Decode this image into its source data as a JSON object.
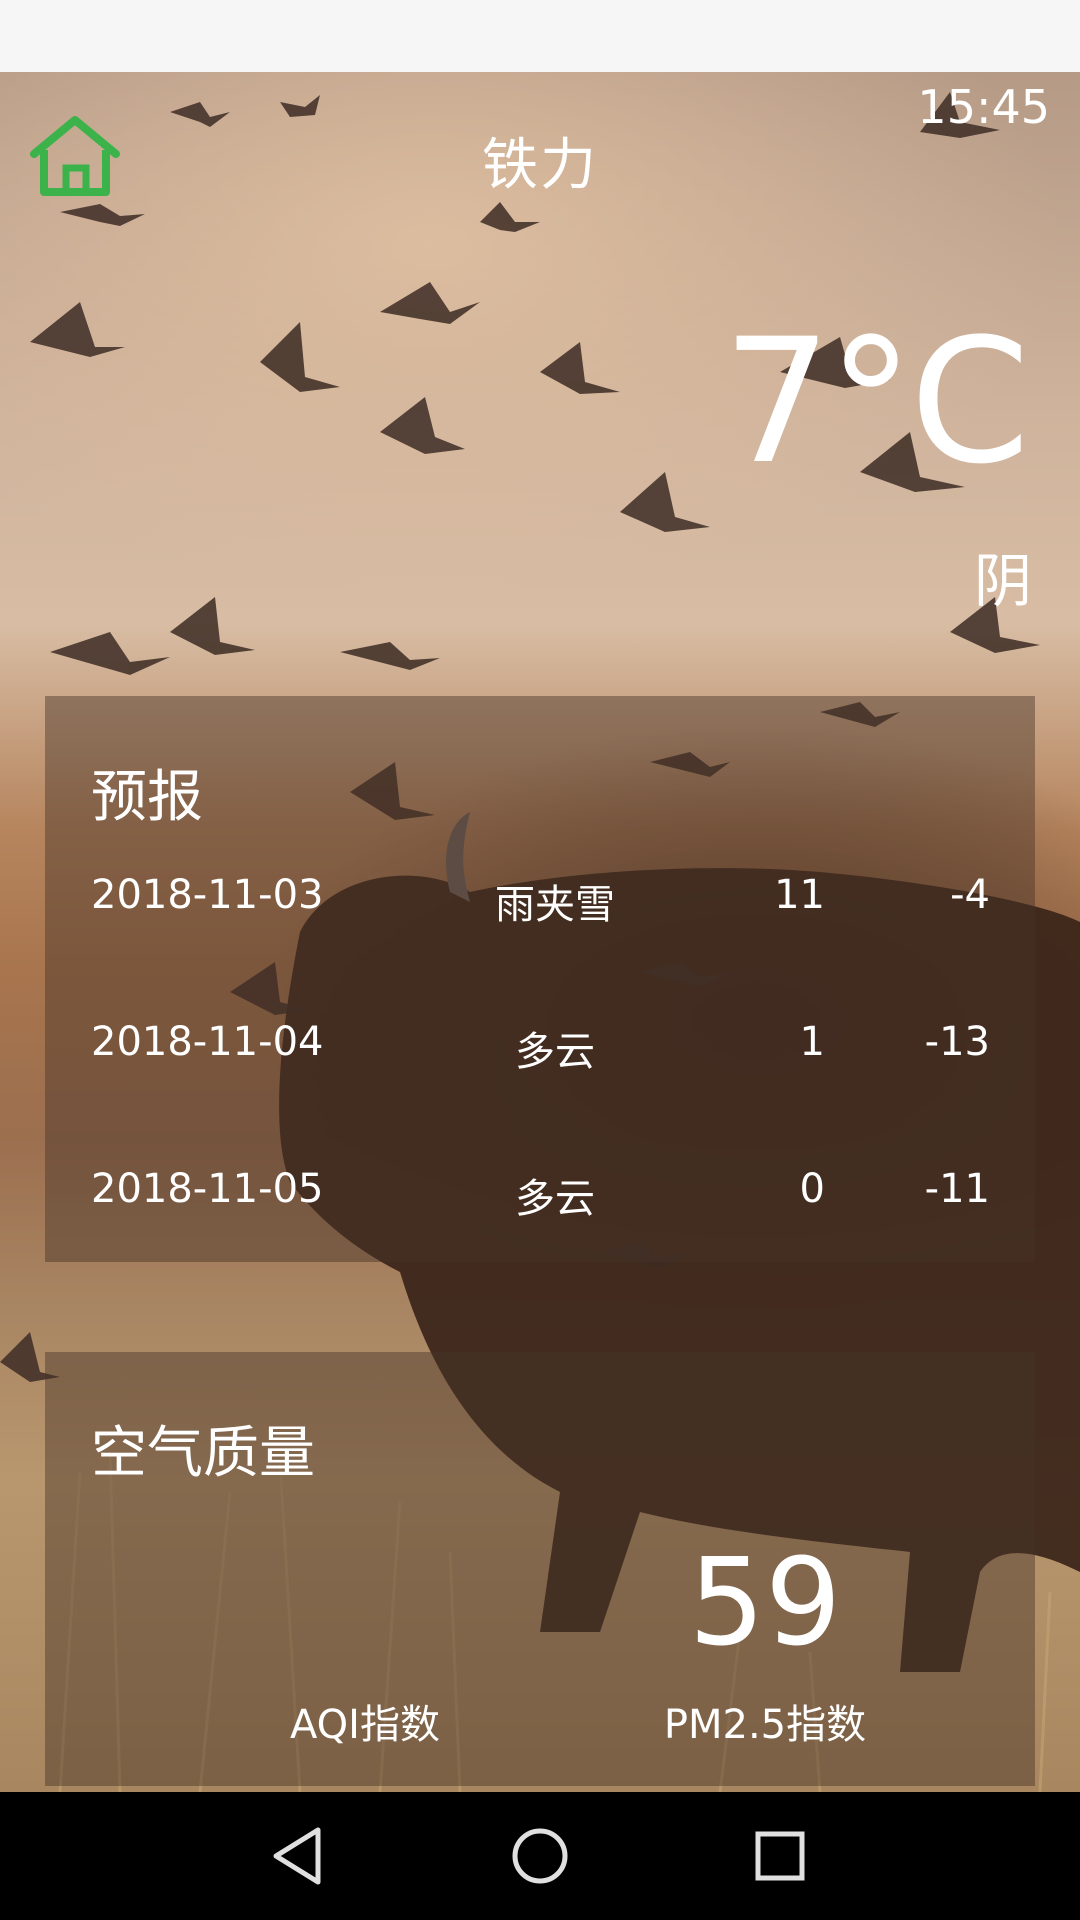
{
  "header": {
    "city": "铁力",
    "time": "15:45",
    "home_icon": "home-icon",
    "home_icon_color": "#3bb34a"
  },
  "current": {
    "temperature": "7°C",
    "condition": "阴"
  },
  "forecast": {
    "title": "预报",
    "rows": [
      {
        "date": "2018-11-03",
        "condition": "雨夹雪",
        "high": "11",
        "low": "-4"
      },
      {
        "date": "2018-11-04",
        "condition": "多云",
        "high": "1",
        "low": "-13"
      },
      {
        "date": "2018-11-05",
        "condition": "多云",
        "high": "0",
        "low": "-11"
      }
    ]
  },
  "air_quality": {
    "title": "空气质量",
    "value": "59",
    "aqi_label": "AQI指数",
    "pm25_label": "PM2.5指数"
  },
  "navbar": {
    "back_icon": "back-triangle-icon",
    "home_icon": "home-circle-icon",
    "recent_icon": "recent-square-icon"
  },
  "colors": {
    "panel_overlay": "rgba(70,50,40,0.45)",
    "text": "#ffffff",
    "navbar": "#000000"
  }
}
